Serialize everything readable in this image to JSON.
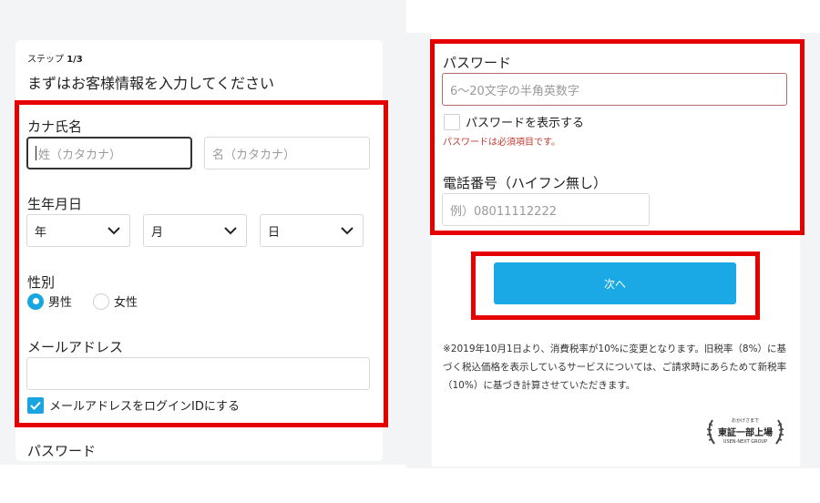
{
  "left": {
    "step_prefix": "ステップ",
    "step_value": "1/3",
    "heading": "まずはお客様情報を入力してください",
    "kana_label": "カナ氏名",
    "last_name_placeholder": "姓（カタカナ）",
    "first_name_placeholder": "名（カタカナ）",
    "dob_label": "生年月日",
    "year": "年",
    "month": "月",
    "day": "日",
    "gender_label": "性別",
    "gender_options": [
      "男性",
      "女性"
    ],
    "gender_selected": "男性",
    "email_label": "メールアドレス",
    "email_value": "",
    "login_id_check_label": "メールアドレスをログインIDにする",
    "login_id_checked": true,
    "password_label_cut": "パスワード"
  },
  "right": {
    "password_label": "パスワード",
    "password_placeholder": "6～20文字の半角英数字",
    "show_password_label": "パスワードを表示する",
    "show_password_checked": false,
    "password_error": "パスワードは必須項目です。",
    "phone_label": "電話番号（ハイフン無し）",
    "phone_placeholder": "例）08011112222",
    "next_button": "次へ",
    "note": "※2019年10月1日より、消費税率が10%に変更となります。旧税率（8%）に基づく税込価格を表示しているサービスについては、ご請求時にあらためて新税率（10%）に基づき計算させていただきます。",
    "badge_top": "おかげさまで",
    "badge_main": "東証一部上場",
    "badge_bottom": "USEN-NEXT GROUP"
  },
  "colors": {
    "accent": "#1aa9e5",
    "highlight": "#e60000",
    "error": "#c0392b"
  }
}
